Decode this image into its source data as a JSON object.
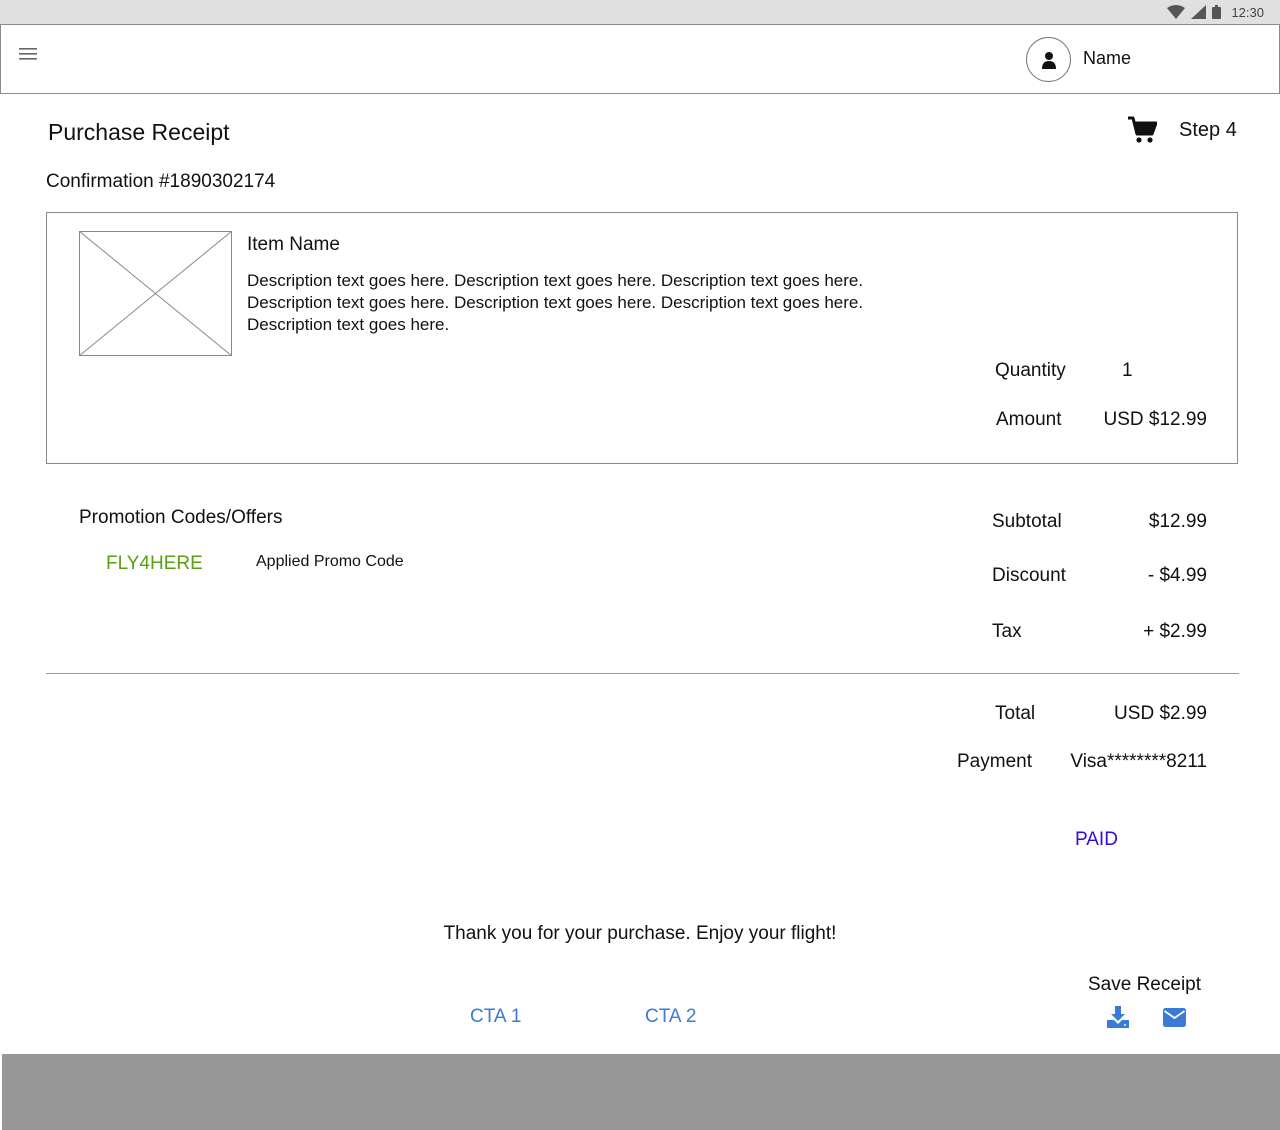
{
  "status_bar": {
    "time": "12:30"
  },
  "header": {
    "user_name": "Name"
  },
  "page": {
    "title": "Purchase Receipt",
    "step": "Step 4",
    "confirmation": "Confirmation #1890302174"
  },
  "item": {
    "name": "Item Name",
    "description": "Description text goes here. Description text goes here. Description text goes here. Description text goes here. Description text goes here. Description text goes here. Description text goes here.",
    "quantity_label": "Quantity",
    "quantity": "1",
    "amount_label": "Amount",
    "amount": "USD $12.99"
  },
  "promo": {
    "title": "Promotion Codes/Offers",
    "code": "FLY4HERE",
    "status": "Applied Promo Code"
  },
  "summary": {
    "subtotal_label": "Subtotal",
    "subtotal": "$12.99",
    "discount_label": "Discount",
    "discount": "- $4.99",
    "tax_label": "Tax",
    "tax": "+ $2.99",
    "total_label": "Total",
    "total": "USD $2.99",
    "payment_label": "Payment",
    "payment": "Visa********8211",
    "paid": "PAID"
  },
  "footer_area": {
    "thanks": "Thank you for your purchase. Enjoy your flight!",
    "cta1": "CTA 1",
    "cta2": "CTA 2",
    "save_receipt": "Save Receipt"
  },
  "colors": {
    "promo_code": "#5a9e12",
    "paid": "#2a0fd8",
    "cta": "#3b7ad6",
    "bottom_bar": "#979797"
  },
  "icons": [
    "wifi-icon",
    "signal-icon",
    "battery-icon",
    "menu-icon",
    "user-icon",
    "cart-icon",
    "download-icon",
    "mail-icon",
    "image-placeholder"
  ]
}
